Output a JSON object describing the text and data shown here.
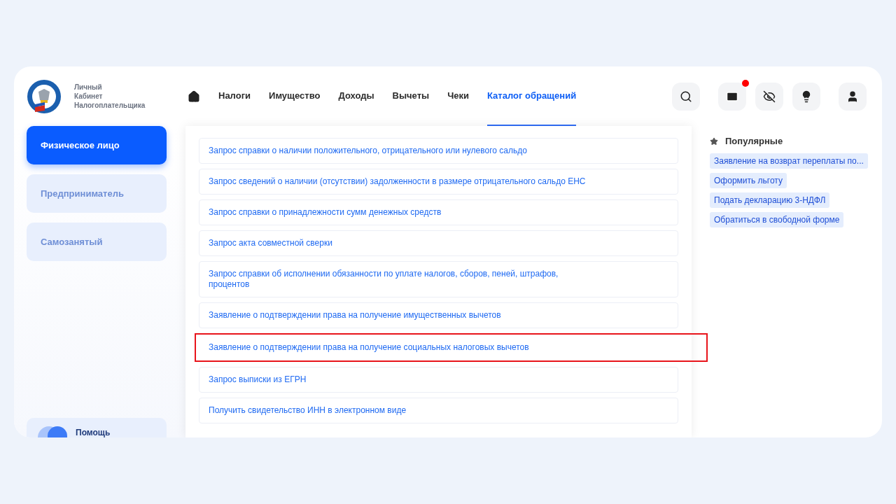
{
  "brand": {
    "lines": [
      "Личный",
      "Кабинет",
      "Налогоплательщика"
    ]
  },
  "nav": [
    {
      "label": "Налоги",
      "selected": false
    },
    {
      "label": "Имущество",
      "selected": false
    },
    {
      "label": "Доходы",
      "selected": false
    },
    {
      "label": "Вычеты",
      "selected": false
    },
    {
      "label": "Чеки",
      "selected": false
    },
    {
      "label": "Каталог обращений",
      "selected": true
    }
  ],
  "notifications": {
    "unread": true
  },
  "sidebar": {
    "items": [
      {
        "label": "Физическое лицо",
        "selected": true
      },
      {
        "label": "Предприниматель",
        "selected": false
      },
      {
        "label": "Самозанятый",
        "selected": false
      }
    ],
    "help": "Помощь"
  },
  "requests": [
    {
      "label": "Запрос справки о наличии положительного, отрицательного или нулевого сальдо",
      "highlighted": false
    },
    {
      "label": "Запрос сведений о наличии (отсутствии) задолженности в размере отрицательного сальдо ЕНС",
      "highlighted": false
    },
    {
      "label": "Запрос справки о принадлежности сумм денежных средств",
      "highlighted": false
    },
    {
      "label": "Запрос акта совместной сверки",
      "highlighted": false
    },
    {
      "label": "Запрос справки об исполнении обязанности по уплате налогов, сборов, пеней, штрафов, процентов",
      "highlighted": false
    },
    {
      "label": "Заявление о подтверждении права на получение имущественных вычетов",
      "highlighted": false
    },
    {
      "label": "Заявление о подтверждении права на получение социальных налоговых вычетов",
      "highlighted": true
    },
    {
      "label": "Запрос выписки из ЕГРН",
      "highlighted": false
    },
    {
      "label": "Получить свидетельство ИНН в электронном виде",
      "highlighted": false
    }
  ],
  "popular": {
    "title": "Популярные",
    "items": [
      "Заявление на возврат переплаты по...",
      "Оформить льготу",
      "Подать декларацию 3-НДФЛ",
      "Обратиться в свободной форме"
    ]
  }
}
